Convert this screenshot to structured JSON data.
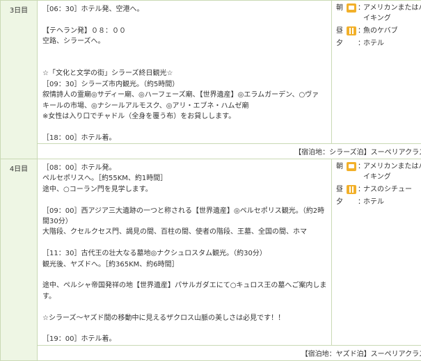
{
  "days": [
    {
      "label": "3日目",
      "lines": [
        "［06：30］ホテル発、空港へ。",
        "",
        "【テヘラン発】０８：００",
        "空路、シラーズへ。",
        "",
        "",
        "☆「文化と文学の街」シラーズ終日観光☆",
        "［09：30］シラーズ市内観光。（約5時間）",
        "叙情詩人の霊廟◎サディー廟、◎ハーフェーズ廟、【世界遺産】◎エラムガーデン、○ヴァ",
        "キールの市場、◎ナシールアルモスク、◎アリ・エブネ・ハムゼ廟",
        "※女性は入り口でチャドル（全身を覆う布）をお貸しします。",
        "",
        "［18：00］ホテル着。"
      ],
      "meals": [
        {
          "label": "朝",
          "icon": "cup-icon",
          "text": "アメリカンまたはバイキング"
        },
        {
          "label": "昼",
          "icon": "cutlery-icon",
          "text": "魚のケバブ"
        },
        {
          "label": "夕",
          "icon": "none",
          "text": "ホテル"
        }
      ],
      "hotel": "【宿泊地：シラーズ泊】スーペリアクラス"
    },
    {
      "label": "4日目",
      "lines": [
        "［08：00］ホテル発。",
        "ペルセポリスへ。［約55KM、約1時間］",
        "途中、○コーラン門を見学します。",
        "",
        "［09：00］西アジア三大遺跡の一つと称される【世界遺産】◎ペルセポリス観光。（約2時",
        "間30分）",
        "大階段、クセルクセス門、謁見の間、百柱の間、使者の階段、王墓、全国の間、ホマ",
        "",
        "［11：30］古代王の壮大なる墓地◎ナクシュロスタム観光。（約30分）",
        "観光後、ヤズドへ。［約365KM、約6時間］",
        "",
        "途中、ペルシャ帝国発祥の地【世界遺産】パサルガダエにて○キュロス王の墓へご案内しま",
        "す。",
        "",
        "☆シラーズ～ヤズド間の移動中に見えるザクロス山脈の美しさは必見です！！",
        "",
        "［19：00］ホテル着。"
      ],
      "meals": [
        {
          "label": "朝",
          "icon": "cup-icon",
          "text": "アメリカンまたはバイキング"
        },
        {
          "label": "昼",
          "icon": "cutlery-icon",
          "text": "ナスのシチュー"
        },
        {
          "label": "夕",
          "icon": "none",
          "text": "ホテル"
        }
      ],
      "hotel": "【宿泊地：ヤズド泊】スーペリアクラス"
    }
  ]
}
